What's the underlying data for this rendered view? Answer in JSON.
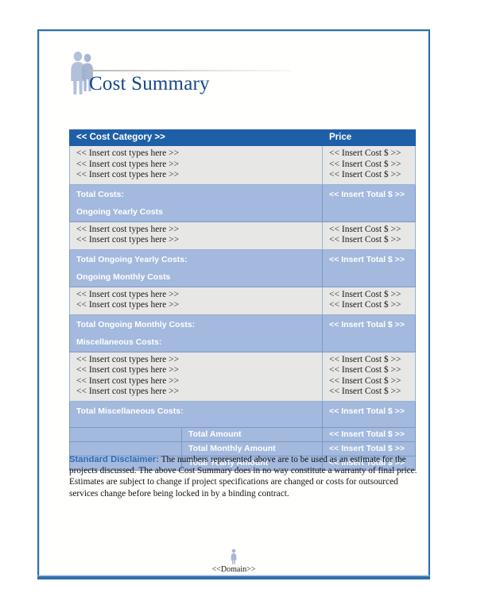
{
  "document": {
    "title": "Cost Summary",
    "logo_icon": "two-people-silhouette-icon"
  },
  "table": {
    "header": {
      "category": "<< Cost Category >>",
      "price": "Price"
    },
    "placeholders": {
      "cost_type": "<< Insert cost types here >>",
      "cost_value": "<< Insert Cost $ >>",
      "total_value": "<< Insert Total $ >>"
    },
    "sections": [
      {
        "kind": "data",
        "rows": [
          {
            "label": "<< Insert cost types here >>",
            "value": "<< Insert Cost $ >>"
          },
          {
            "label": "<< Insert cost types here >>",
            "value": "<< Insert Cost $ >>"
          },
          {
            "label": "<< Insert cost types here >>",
            "value": "<< Insert Cost $ >>"
          }
        ]
      },
      {
        "kind": "summary",
        "total_label": "Total Costs:",
        "next_heading": "Ongoing Yearly Costs",
        "value": "<< Insert Total $ >>"
      },
      {
        "kind": "data",
        "rows": [
          {
            "label": "<< Insert cost types here >>",
            "value": "<< Insert Cost $ >>"
          },
          {
            "label": "<< Insert cost types here >>",
            "value": "<< Insert Cost $ >>"
          }
        ]
      },
      {
        "kind": "summary",
        "total_label": "Total Ongoing Yearly Costs:",
        "next_heading": "Ongoing Monthly Costs",
        "value": "<< Insert Total $ >>"
      },
      {
        "kind": "data",
        "rows": [
          {
            "label": "<< Insert cost types here >>",
            "value": "<< Insert Cost $ >>"
          },
          {
            "label": "<< Insert cost types here >>",
            "value": "<< Insert Cost $ >>"
          }
        ]
      },
      {
        "kind": "summary",
        "total_label": "Total Ongoing Monthly Costs:",
        "next_heading": "Miscellaneous Costs:",
        "value": "<< Insert Total $ >>"
      },
      {
        "kind": "data",
        "rows": [
          {
            "label": "<< Insert cost types here >>",
            "value": "<< Insert Cost $ >>"
          },
          {
            "label": "<< Insert cost types here >>",
            "value": "<< Insert Cost $ >>"
          },
          {
            "label": "<< Insert cost types here >>",
            "value": "<< Insert Cost $ >>"
          },
          {
            "label": "<< Insert cost types here >>",
            "value": "<< Insert Cost $ >>"
          }
        ]
      },
      {
        "kind": "summary",
        "total_label": "Total Miscellaneous Costs:",
        "next_heading": "",
        "value": "<< Insert Total $ >>"
      }
    ],
    "grand_totals": [
      {
        "label": "Total Amount",
        "value": "<< Insert Total $ >>"
      },
      {
        "label": "Total Monthly Amount",
        "value": "<< Insert Total $ >>"
      },
      {
        "label": "Total Yearly Amount",
        "value": "<< Insert Total $ >>"
      }
    ]
  },
  "disclaimer": {
    "lead": "Standard Disclaimer:",
    "body": " The numbers represented above are to be used as an estimate for the projects discussed. The above Cost Summary does in no way constitute a warranty of final price. Estimates are subject to change if project specifications are changed or costs for outsourced services change before being locked in by a binding contract."
  },
  "footer": {
    "text": "<<Domain>>",
    "icon": "person-silhouette-icon"
  },
  "colors": {
    "header_blue": "#1F5FA8",
    "summary_blue": "#A3B9DD",
    "data_gray": "#E7E7E5",
    "border_blue": "#2F6FAD",
    "title_navy": "#16478A",
    "disclaimer_blue": "#2E6DB4"
  }
}
